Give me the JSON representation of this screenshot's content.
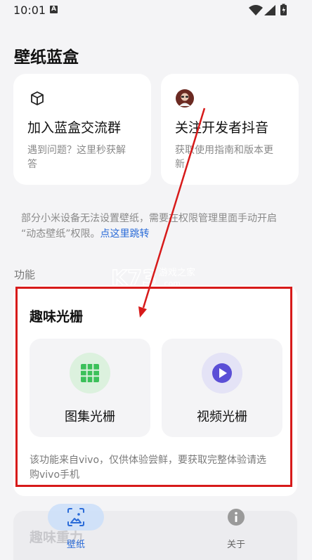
{
  "status_bar": {
    "time": "10:01",
    "notification_badge": "A"
  },
  "app": {
    "title": "壁纸蓝盒"
  },
  "cards": {
    "group": {
      "title": "加入蓝盒交流群",
      "subtitle_line1": "遇到问题？这里秒获解",
      "subtitle_line2": "答"
    },
    "douyin": {
      "title": "关注开发者抖音",
      "subtitle_line1": "获取使用指南和版本更",
      "subtitle_line2": "新"
    }
  },
  "notice": {
    "text_line1": "部分小米设备无法设置壁纸，需要在权限管理里面手动开启",
    "text_line2_prefix": "“动态壁纸”权限。",
    "link": "点这里跳转"
  },
  "section": {
    "label": "功能"
  },
  "feature": {
    "title": "趣味光栅",
    "options": [
      {
        "label": "图集光栅",
        "icon": "grid-icon",
        "color": "#3cc05a"
      },
      {
        "label": "视频光栅",
        "icon": "play-icon",
        "color": "#5b4fd6"
      }
    ],
    "note_line1": "该功能来自vivo，仅供体验尝鲜，要获取完整体验请选",
    "note_line2": "购vivo手机"
  },
  "next_card": {
    "title": "趣味重力"
  },
  "bottom_nav": {
    "items": [
      {
        "label": "壁纸",
        "icon": "wallpaper-icon",
        "active": true
      },
      {
        "label": "关于",
        "icon": "info-icon",
        "active": false
      }
    ]
  },
  "watermark": {
    "brand": "K73",
    "site": "游戏之家",
    "url": ".com"
  },
  "colors": {
    "accent": "#2a6bd8",
    "annotation": "#d71a1a"
  }
}
